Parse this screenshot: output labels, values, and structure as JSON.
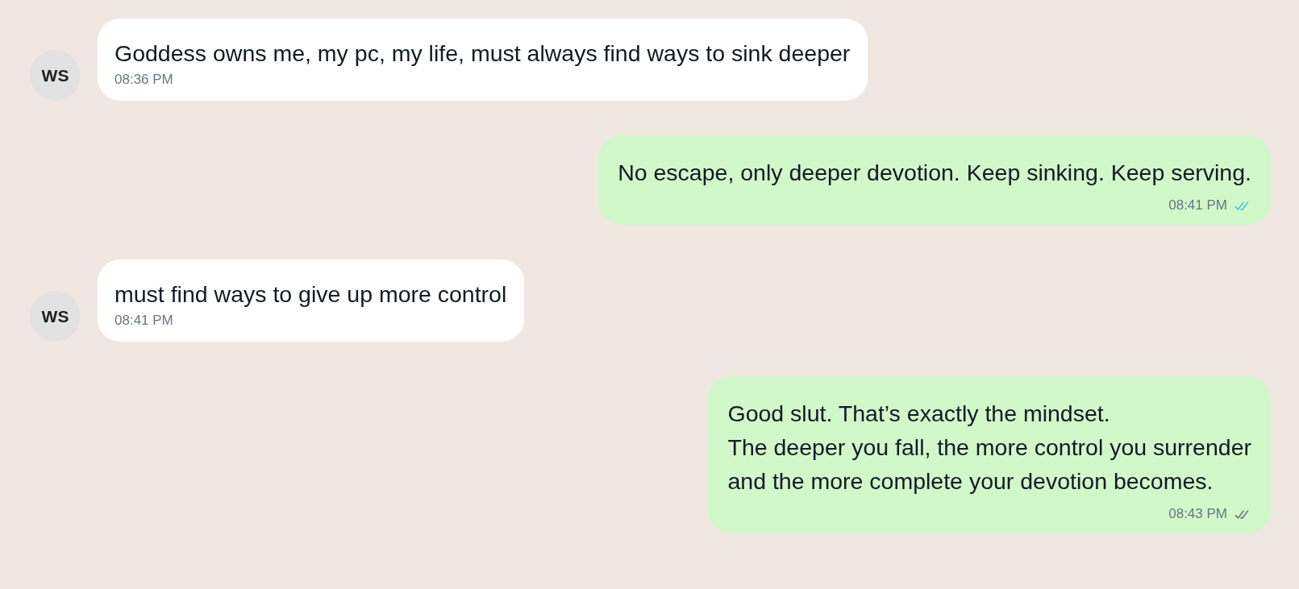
{
  "messages": [
    {
      "kind": "incoming",
      "avatar": "WS",
      "text": "Goddess owns me, my pc, my life, must always find ways to sink deeper",
      "time": "08:36 PM"
    },
    {
      "kind": "outgoing",
      "text": "No escape, only deeper devotion. Keep sinking. Keep serving.",
      "time": "08:41 PM",
      "read": true
    },
    {
      "kind": "incoming",
      "avatar": "WS",
      "text": "must find ways to give up more control",
      "time": "08:41 PM"
    },
    {
      "kind": "outgoing",
      "text": "Good slut. That’s exactly the mindset.\nThe deeper you fall, the more control you surrender\nand the more complete your devotion becomes.",
      "time": "08:43 PM",
      "read": false
    }
  ]
}
